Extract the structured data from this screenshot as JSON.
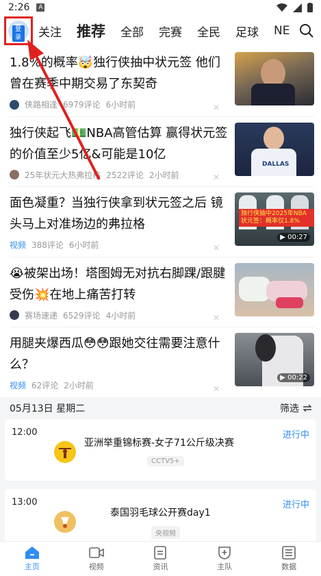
{
  "status": {
    "time": "2:26",
    "sim_label": "A"
  },
  "topnav": {
    "login_label": "登录",
    "tabs": [
      "关注",
      "推荐",
      "全部",
      "完赛",
      "全民",
      "足球",
      "NE"
    ]
  },
  "feed": [
    {
      "title": "1.8%的概率🤯独行侠抽中状元签 他们曾在赛季中期交易了东契奇",
      "source": "侠路相逢",
      "comments": "6979评论",
      "time": "6小时前",
      "is_video": false
    },
    {
      "title": "独行侠起飞💵NBA高管估算 赢得状元签的价值至少5亿&可能是10亿",
      "source": "25年状元大热弗拉格",
      "comments": "2522评论",
      "time": "2小时前",
      "is_video": false
    },
    {
      "title": "面色凝重？当独行侠拿到状元签之后 镜头马上对准场边的弗拉格",
      "source": "视频",
      "comments": "388评论",
      "time": "6小时前",
      "is_video": true,
      "duration": "00:27",
      "banner": "独行侠抽中2025年NBA状元签：概率仅1.8%"
    },
    {
      "title": "😭被架出场！塔图姆无对抗右脚踝/跟腱受伤💥在地上痛苦打转",
      "source": "赛场速递",
      "comments": "6529评论",
      "time": "4小时前",
      "is_video": false
    },
    {
      "title": "用腿夹爆西瓜😳😳跟她交往需要注意什么？",
      "source": "视频",
      "comments": "62评论",
      "time": "2小时前",
      "is_video": true,
      "duration": "00:22"
    }
  ],
  "schedule": {
    "date": "05月13日 星期二",
    "filter_label": "筛选",
    "matches": [
      {
        "time": "12:00",
        "name": "亚洲举重锦标赛-女子71公斤级决赛",
        "channel": "CCTV5+",
        "status": "进行中"
      },
      {
        "time": "13:00",
        "name": "泰国羽毛球公开赛day1",
        "channel": "央视频",
        "status": "进行中"
      }
    ]
  },
  "bottomnav": [
    "主页",
    "视频",
    "资讯",
    "主队",
    "数据"
  ],
  "colors": {
    "accent": "#2f8ef4",
    "annotation": "#e02020"
  }
}
